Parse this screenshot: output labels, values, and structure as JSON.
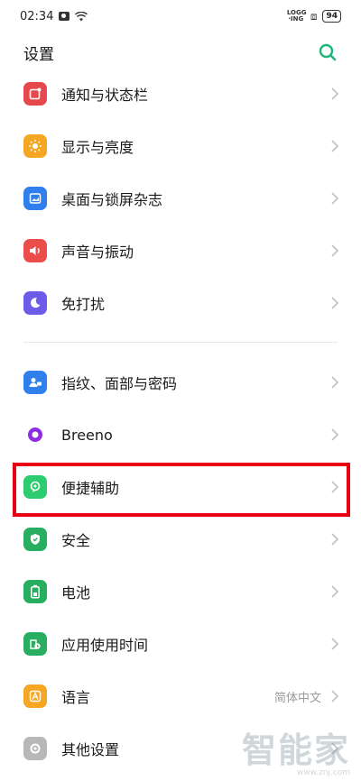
{
  "status_bar": {
    "time": "02:34",
    "carrier_tag": "LOGG ·ING",
    "battery": "94"
  },
  "header": {
    "title": "设置"
  },
  "settings_items": [
    {
      "label": "通知与状态栏",
      "icon": "notification-icon",
      "color": "#e5484d"
    },
    {
      "label": "显示与亮度",
      "icon": "sun-icon",
      "color": "#f5a623"
    },
    {
      "label": "桌面与锁屏杂志",
      "icon": "wallpaper-icon",
      "color": "#2f80ed"
    },
    {
      "label": "声音与振动",
      "icon": "speaker-icon",
      "color": "#eb4d4b"
    },
    {
      "label": "免打扰",
      "icon": "moon-icon",
      "color": "#6c5ce7"
    },
    {
      "label": "指纹、面部与密码",
      "icon": "user-security-icon",
      "color": "#2f80ed"
    },
    {
      "label": "Breeno",
      "icon": "breeno-icon",
      "color": "#8e2de2"
    },
    {
      "label": "便捷辅助",
      "icon": "assist-icon",
      "color": "#2ecc71"
    },
    {
      "label": "安全",
      "icon": "shield-icon",
      "color": "#27ae60"
    },
    {
      "label": "电池",
      "icon": "battery-icon",
      "color": "#27ae60"
    },
    {
      "label": "应用使用时间",
      "icon": "app-time-icon",
      "color": "#27ae60"
    },
    {
      "label": "语言",
      "icon": "language-icon",
      "color": "#f5a623",
      "value": "简体中文"
    },
    {
      "label": "其他设置",
      "icon": "other-settings-icon",
      "color": "#b8b8b8"
    }
  ],
  "colors": {
    "accent": "#1fb57a",
    "highlight": "#e60012"
  },
  "watermark": {
    "main": "智能家",
    "sub": "www.znj.com"
  }
}
